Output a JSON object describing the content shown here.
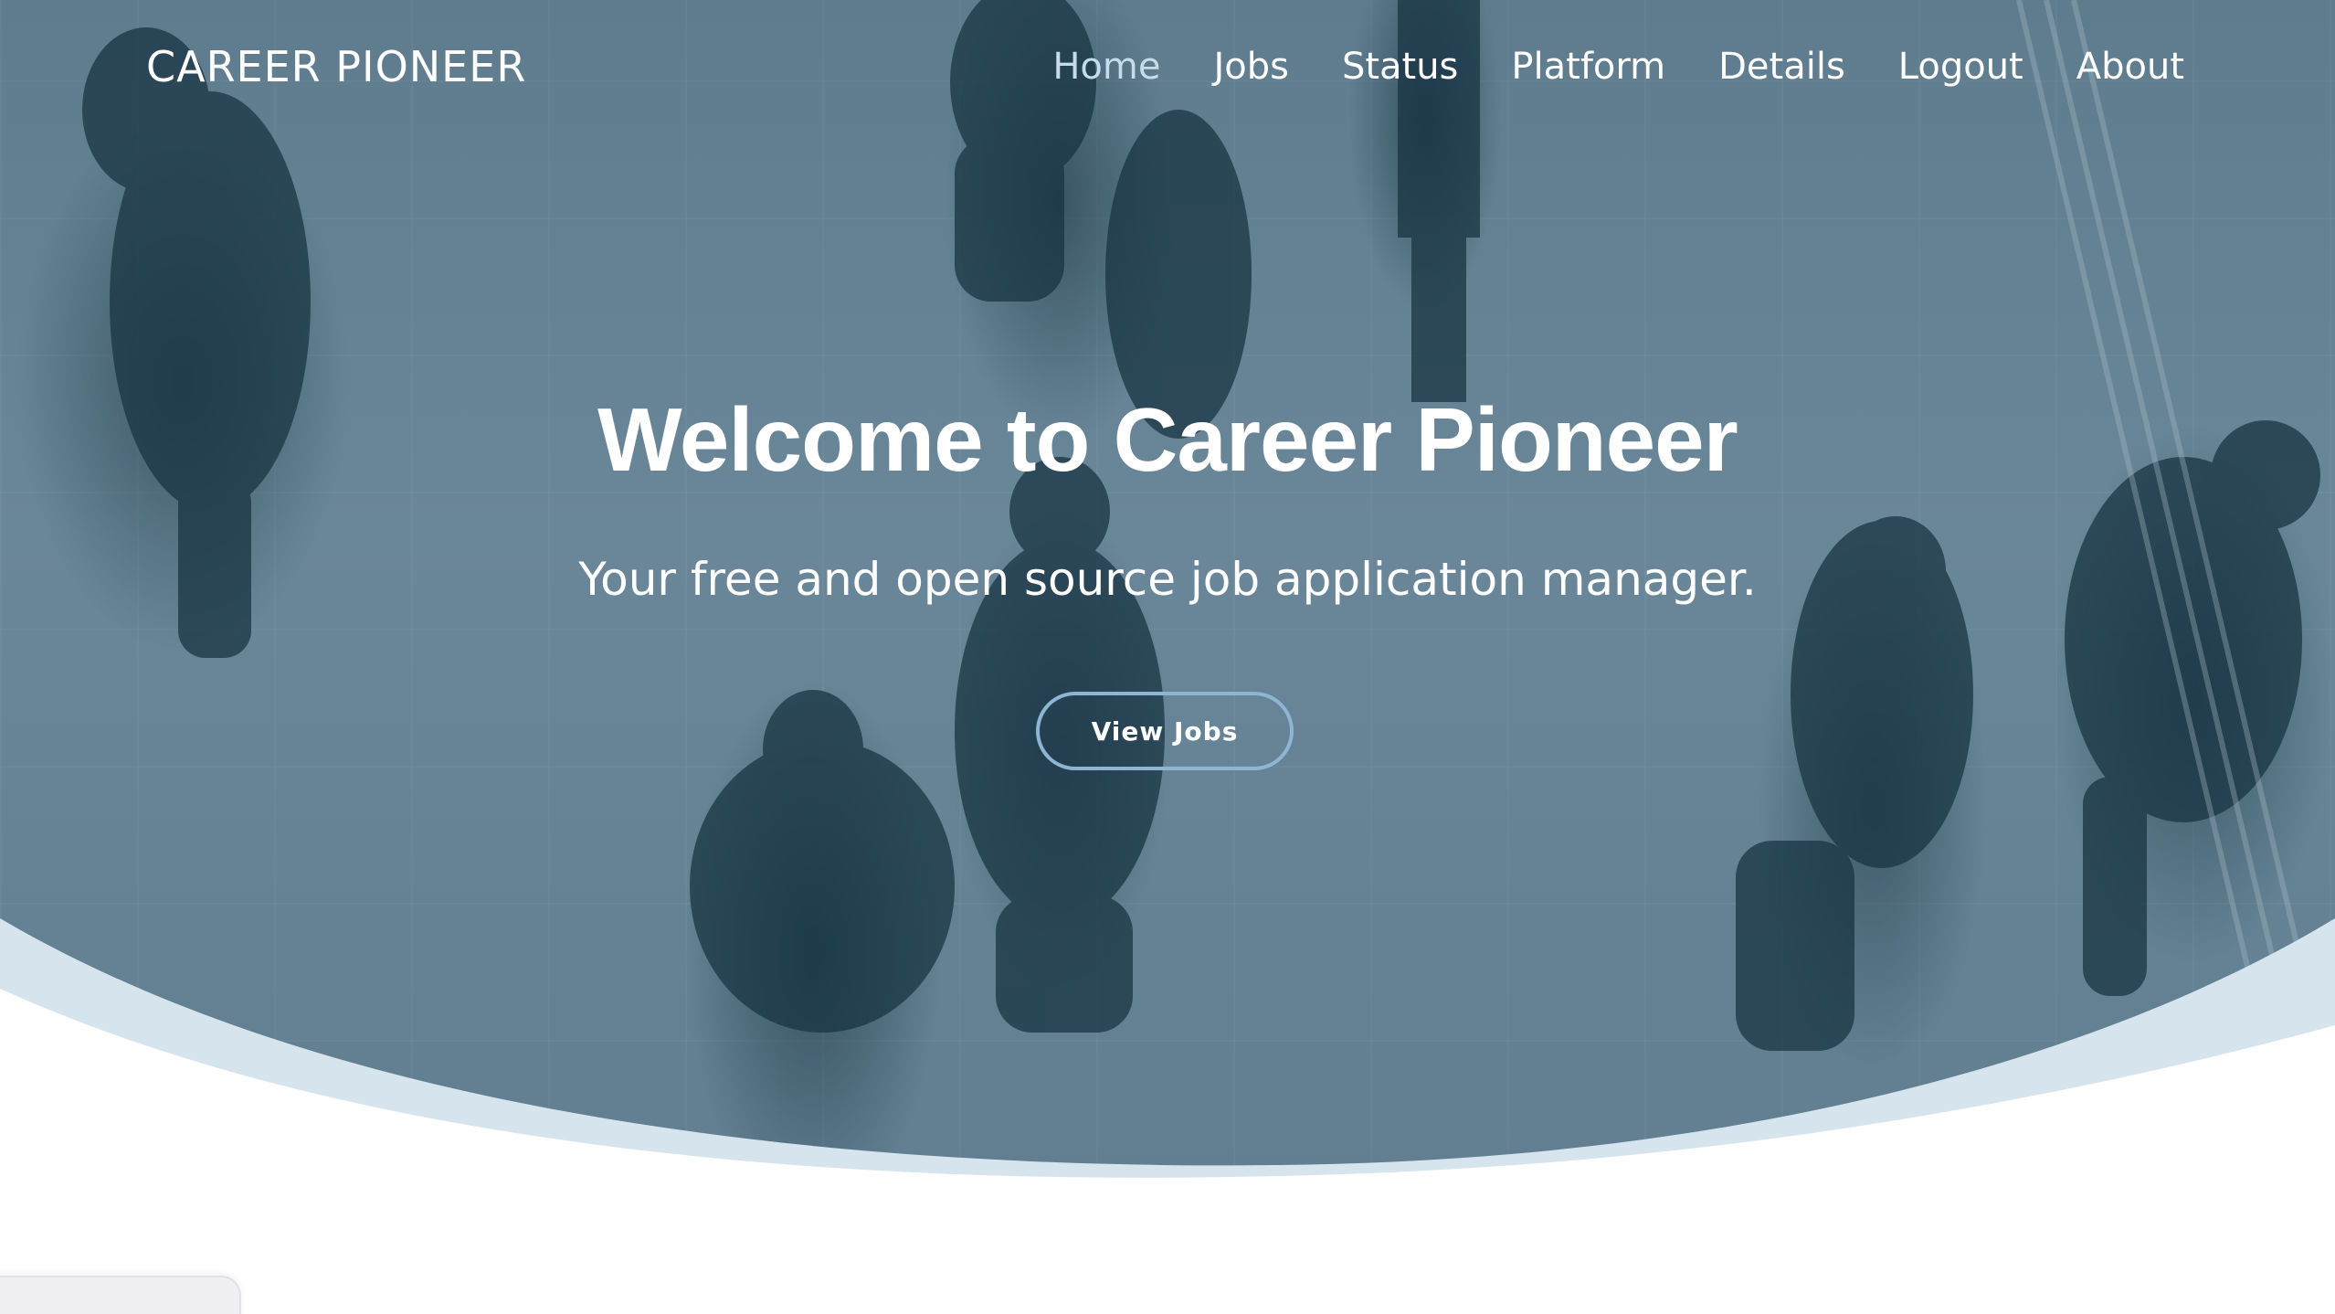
{
  "brand": {
    "name": "CAREER PIONEER"
  },
  "nav": {
    "items": [
      {
        "label": "Home",
        "active": true
      },
      {
        "label": "Jobs",
        "active": false
      },
      {
        "label": "Status",
        "active": false
      },
      {
        "label": "Platform",
        "active": false
      },
      {
        "label": "Details",
        "active": false
      },
      {
        "label": "Logout",
        "active": false
      },
      {
        "label": "About",
        "active": false
      }
    ]
  },
  "hero": {
    "title": "Welcome to Career Pioneer",
    "subtitle": "Your free and open source job application manager.",
    "cta_label": "View Jobs"
  },
  "colors": {
    "hero_overlay": "#617f91",
    "wave_accent": "#d6e5ed",
    "nav_active": "#c6dcec",
    "cta_border": "#8fb5d4",
    "text": "#ffffff"
  }
}
